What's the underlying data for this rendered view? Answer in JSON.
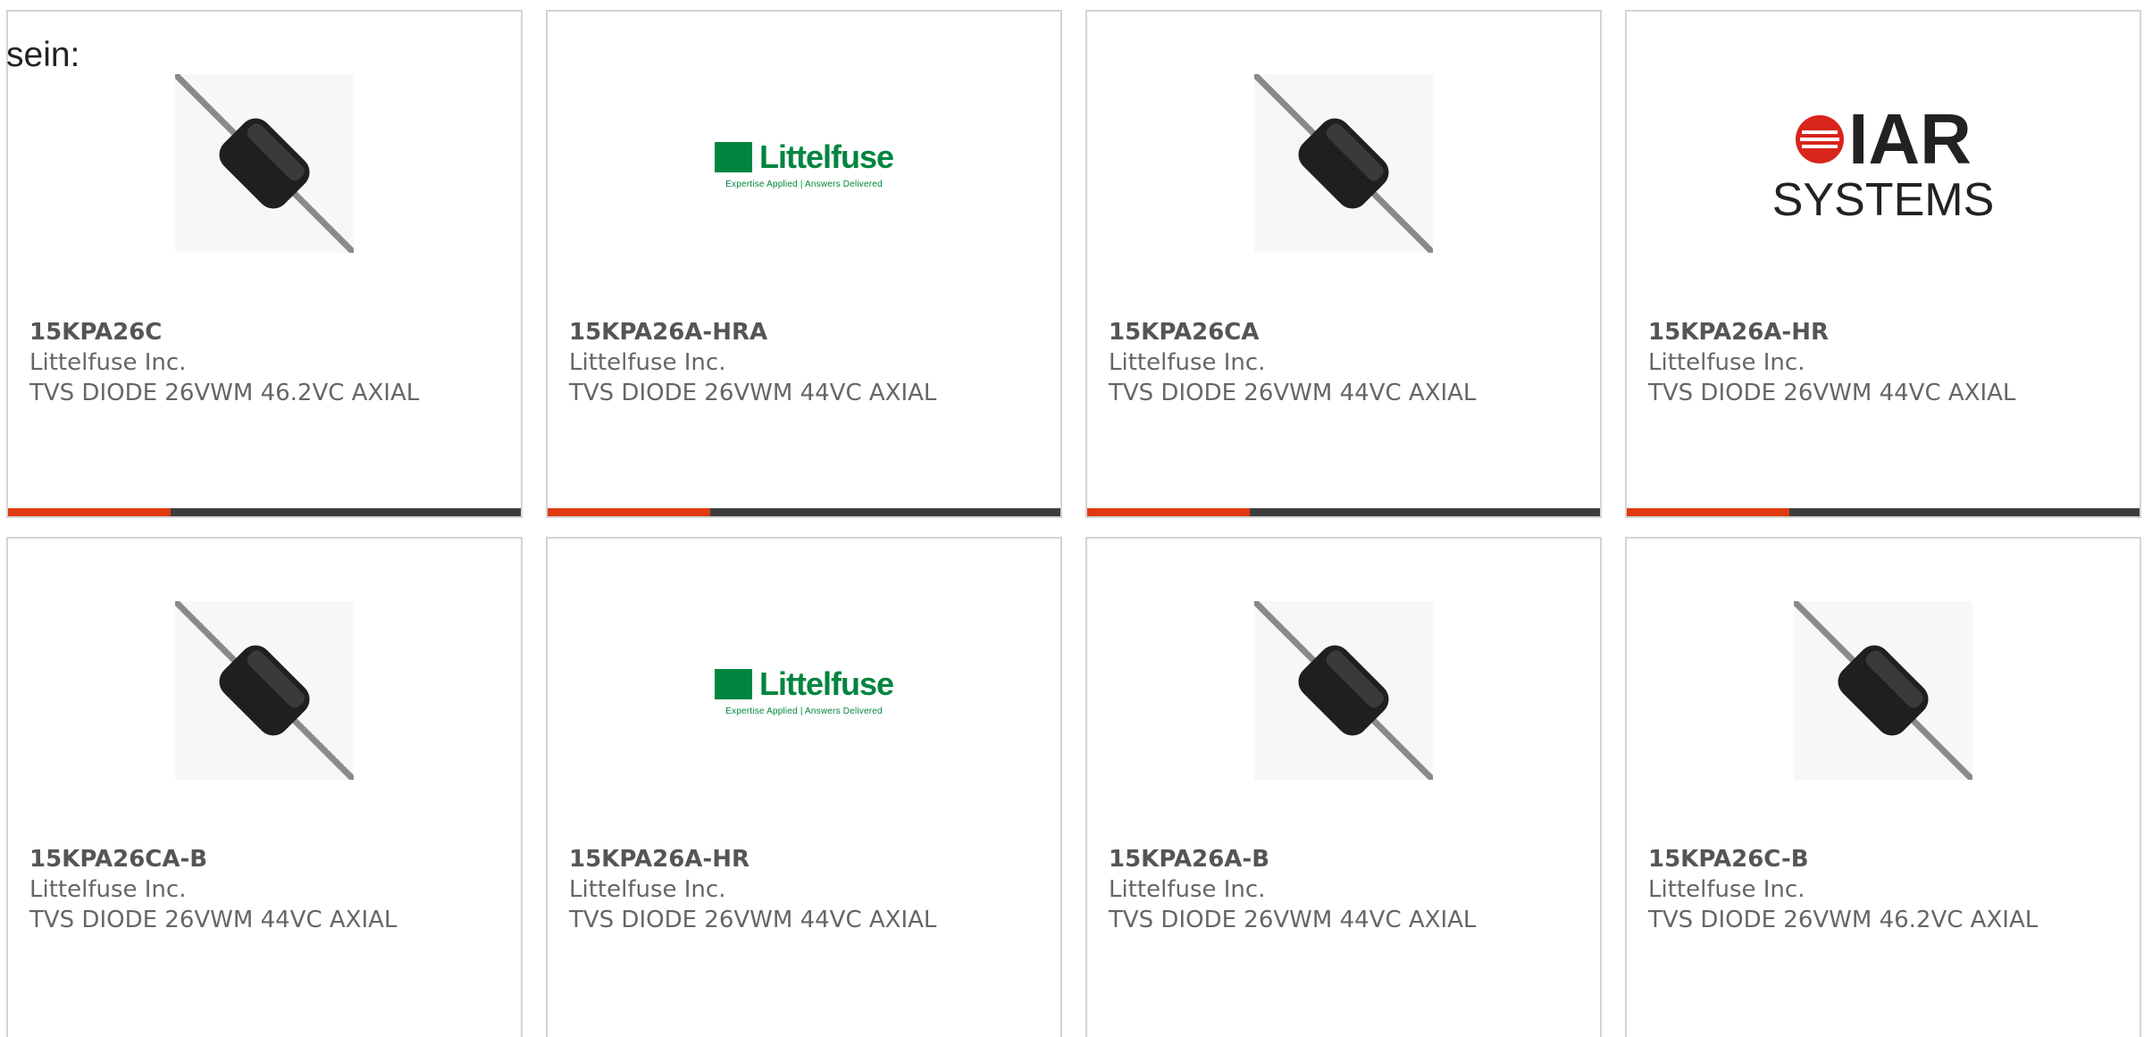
{
  "intro_text": "sein:",
  "accent_color": "#e03a10",
  "cards": [
    {
      "part": "15KPA26C",
      "manufacturer": "Littelfuse Inc.",
      "description": "TVS DIODE 26VWM 46.2VC AXIAL",
      "image": "diode-photo"
    },
    {
      "part": "15KPA26A-HRA",
      "manufacturer": "Littelfuse Inc.",
      "description": "TVS DIODE 26VWM 44VC AXIAL",
      "image": "littelfuse-logo",
      "logo_text": "Littelfuse",
      "logo_tagline": "Expertise Applied | Answers Delivered"
    },
    {
      "part": "15KPA26CA",
      "manufacturer": "Littelfuse Inc.",
      "description": "TVS DIODE 26VWM 44VC AXIAL",
      "image": "diode-photo"
    },
    {
      "part": "15KPA26A-HR",
      "manufacturer": "Littelfuse Inc.",
      "description": "TVS DIODE 26VWM 44VC AXIAL",
      "image": "iar-systems-logo",
      "logo_text": "IAR",
      "logo_sub": "SYSTEMS"
    },
    {
      "part": "15KPA26CA-B",
      "manufacturer": "Littelfuse Inc.",
      "description": "TVS DIODE 26VWM 44VC AXIAL",
      "image": "diode-photo"
    },
    {
      "part": "15KPA26A-HR",
      "manufacturer": "Littelfuse Inc.",
      "description": "TVS DIODE 26VWM 44VC AXIAL",
      "image": "littelfuse-logo",
      "logo_text": "Littelfuse",
      "logo_tagline": "Expertise Applied | Answers Delivered"
    },
    {
      "part": "15KPA26A-B",
      "manufacturer": "Littelfuse Inc.",
      "description": "TVS DIODE 26VWM 44VC AXIAL",
      "image": "diode-photo"
    },
    {
      "part": "15KPA26C-B",
      "manufacturer": "Littelfuse Inc.",
      "description": "TVS DIODE 26VWM 46.2VC AXIAL",
      "image": "diode-photo"
    }
  ]
}
